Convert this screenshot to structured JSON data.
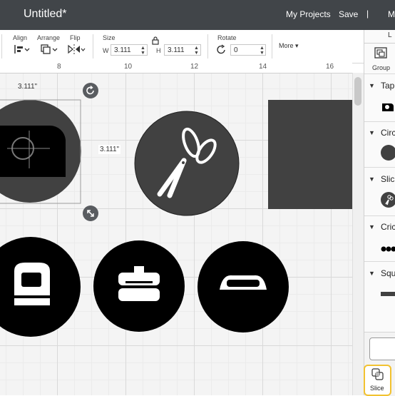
{
  "header": {
    "title": "Untitled*",
    "my_projects": "My Projects",
    "save": "Save",
    "separator": "|",
    "make": "M",
    "bg_color": "#414549"
  },
  "toolbar": {
    "align": "Align",
    "arrange": "Arrange",
    "flip": "Flip",
    "size": "Size",
    "w_label": "W",
    "w_value": "3.111",
    "h_label": "H",
    "h_value": "3.111",
    "rotate": "Rotate",
    "rotate_value": "0",
    "more": "More"
  },
  "ruler": {
    "ticks": [
      "8",
      "10",
      "12",
      "14",
      "16"
    ]
  },
  "canvas": {
    "width_readout": "3.111\"",
    "height_readout": "3.111\""
  },
  "right_panel": {
    "top_label": "L",
    "group": "Group",
    "layers": [
      {
        "label": "Tap"
      },
      {
        "label": "Circ"
      },
      {
        "label": "Slic"
      },
      {
        "label": "Cric"
      },
      {
        "label": "Squ"
      }
    ],
    "slice": "Slice",
    "highlight_color": "#f2c230"
  },
  "colors": {
    "shape_dark": "#414141",
    "shape_black": "#000000"
  }
}
